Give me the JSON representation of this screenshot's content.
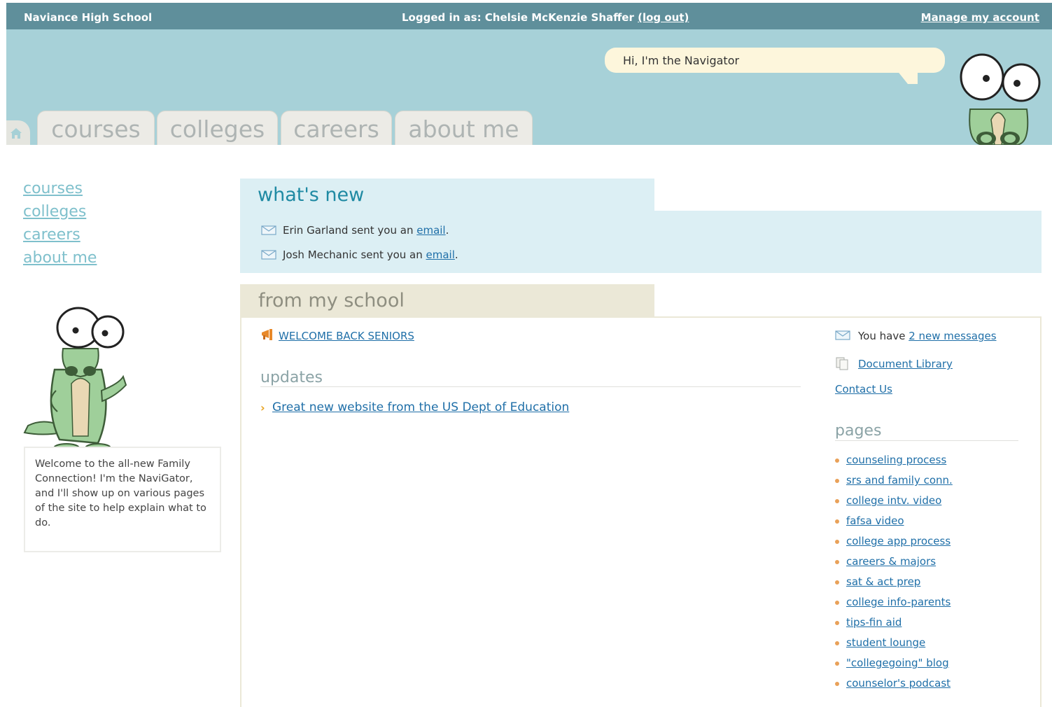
{
  "topbar": {
    "school_name": "Naviance High School",
    "logged_in_prefix": "Logged in as: Chelsie McKenzie Shaffer ",
    "logout_label": "(log out)",
    "manage_account_label": "Manage my account"
  },
  "header": {
    "navigator_greeting": "Hi, I'm the Navigator",
    "home_icon": "home-icon",
    "tabs": [
      {
        "label": "courses"
      },
      {
        "label": "colleges"
      },
      {
        "label": "careers"
      },
      {
        "label": "about me"
      }
    ]
  },
  "leftnav": {
    "items": [
      {
        "label": "courses"
      },
      {
        "label": "colleges"
      },
      {
        "label": "careers"
      },
      {
        "label": "about me"
      }
    ]
  },
  "welcome": {
    "text": "Welcome to the all-new Family Connection! I'm the NaviGator, and I'll show up on various pages of the site to help explain what to do."
  },
  "whats_new": {
    "title": "what's new",
    "messages": [
      {
        "prefix": "Erin Garland sent you an ",
        "link": "email",
        "suffix": "."
      },
      {
        "prefix": "Josh Mechanic sent you an ",
        "link": "email",
        "suffix": "."
      }
    ]
  },
  "from_my_school": {
    "title": "from my school",
    "announcement": "WELCOME BACK SENIORS",
    "updates_title": "updates",
    "updates": [
      {
        "label": "Great new website from the US Dept of Education"
      }
    ],
    "messages_prefix": "You have ",
    "messages_link": "2 new messages",
    "document_library": "Document Library",
    "contact_us": "Contact Us",
    "pages_title": "pages",
    "pages": [
      {
        "label": "counseling process"
      },
      {
        "label": "srs and family conn."
      },
      {
        "label": "college intv. video"
      },
      {
        "label": "fafsa video"
      },
      {
        "label": "college app process"
      },
      {
        "label": "careers & majors"
      },
      {
        "label": "sat & act prep"
      },
      {
        "label": "college info-parents"
      },
      {
        "label": "tips-fin aid"
      },
      {
        "label": "student lounge"
      },
      {
        "label": "\"collegegoing\" blog"
      },
      {
        "label": "counselor's podcast"
      }
    ]
  },
  "colors": {
    "topbar": "#5f8f9b",
    "header": "#a7d1d8",
    "whats_new_bg": "#dceff4",
    "from_school_bg": "#ebe8d7",
    "link": "#1f6fa8"
  }
}
